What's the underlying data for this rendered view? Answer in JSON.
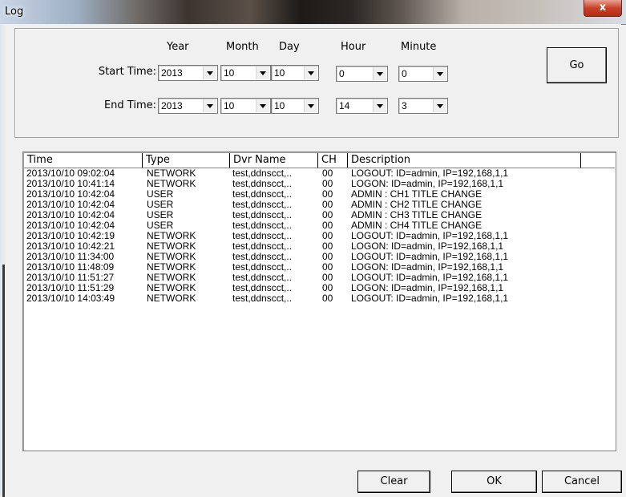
{
  "window": {
    "title": "Log",
    "close_glyph": "x"
  },
  "filter": {
    "headers": {
      "year": "Year",
      "month": "Month",
      "day": "Day",
      "hour": "Hour",
      "minute": "Minute"
    },
    "start": {
      "label": "Start Time:",
      "year": "2013",
      "month": "10",
      "day": "10",
      "hour": "0",
      "minute": "0"
    },
    "end": {
      "label": "End Time:",
      "year": "2013",
      "month": "10",
      "day": "10",
      "hour": "14",
      "minute": "3"
    },
    "go_label": "Go"
  },
  "log": {
    "columns": [
      "Time",
      "Type",
      "Dvr Name",
      "CH",
      "Description"
    ],
    "rows": [
      [
        "2013/10/10 09:02:04",
        "NETWORK",
        "test,ddnscct,..",
        "00",
        "LOGOUT: ID=admin, IP=192,168,1,1"
      ],
      [
        "2013/10/10 10:41:14",
        "NETWORK",
        "test,ddnscct,..",
        "00",
        "LOGON: ID=admin, IP=192,168,1,1"
      ],
      [
        "2013/10/10 10:42:04",
        "USER",
        "test,ddnscct,..",
        "00",
        "ADMIN : CH1 TITLE CHANGE"
      ],
      [
        "2013/10/10 10:42:04",
        "USER",
        "test,ddnscct,..",
        "00",
        "ADMIN : CH2 TITLE CHANGE"
      ],
      [
        "2013/10/10 10:42:04",
        "USER",
        "test,ddnscct,..",
        "00",
        "ADMIN : CH3 TITLE CHANGE"
      ],
      [
        "2013/10/10 10:42:04",
        "USER",
        "test,ddnscct,..",
        "00",
        "ADMIN : CH4 TITLE CHANGE"
      ],
      [
        "2013/10/10 10:42:19",
        "NETWORK",
        "test,ddnscct,..",
        "00",
        "LOGOUT: ID=admin, IP=192,168,1,1"
      ],
      [
        "2013/10/10 10:42:21",
        "NETWORK",
        "test,ddnscct,..",
        "00",
        "LOGON: ID=admin, IP=192,168,1,1"
      ],
      [
        "2013/10/10 11:34:00",
        "NETWORK",
        "test,ddnscct,..",
        "00",
        "LOGOUT: ID=admin, IP=192,168,1,1"
      ],
      [
        "2013/10/10 11:48:09",
        "NETWORK",
        "test,ddnscct,..",
        "00",
        "LOGON: ID=admin, IP=192,168,1,1"
      ],
      [
        "2013/10/10 11:51:27",
        "NETWORK",
        "test,ddnscct,..",
        "00",
        "LOGOUT: ID=admin, IP=192,168,1,1"
      ],
      [
        "2013/10/10 11:51:29",
        "NETWORK",
        "test,ddnscct,..",
        "00",
        "LOGON: ID=admin, IP=192,168,1,1"
      ],
      [
        "2013/10/10 14:03:49",
        "NETWORK",
        "test,ddnscct,..",
        "00",
        "LOGOUT: ID=admin, IP=192,168,1,1"
      ]
    ]
  },
  "footer": {
    "clear_label": "Clear",
    "ok_label": "OK",
    "cancel_label": "Cancel"
  }
}
